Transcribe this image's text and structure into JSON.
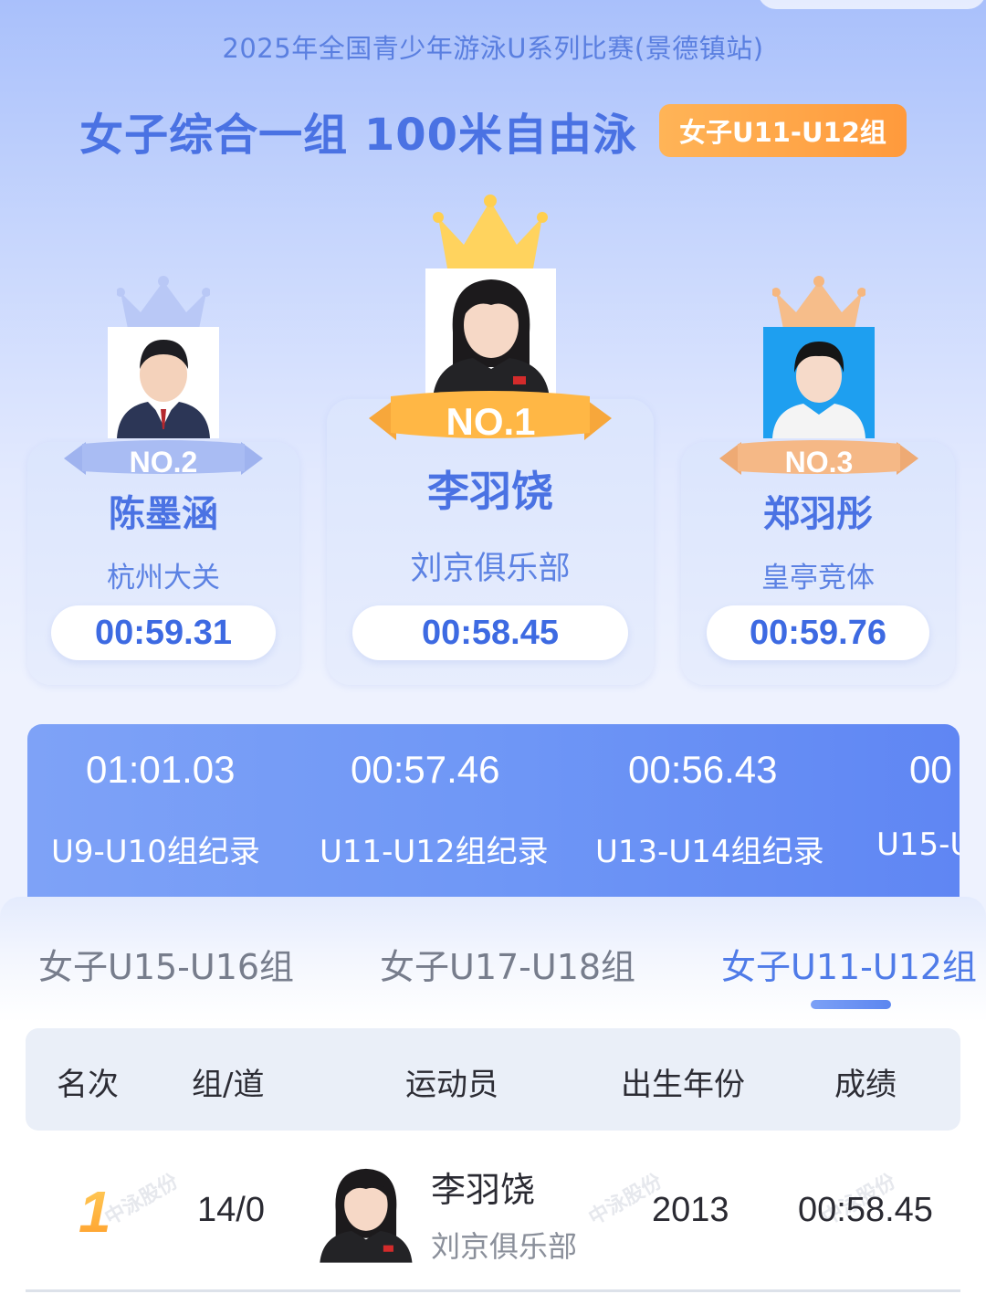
{
  "event_title": "2025年全国青少年游泳U系列比赛(景德镇站)",
  "heading": "女子综合一组 100米自由泳",
  "group_badge": "女子U11-U12组",
  "podium": [
    {
      "rank_label": "NO.2",
      "name": "陈墨涵",
      "club": "杭州大关",
      "time": "00:59.31",
      "crown_color": "#b9c8f6"
    },
    {
      "rank_label": "NO.1",
      "name": "李羽饶",
      "club": "刘京俱乐部",
      "time": "00:58.45",
      "crown_color": "#ffd35e"
    },
    {
      "rank_label": "NO.3",
      "name": "郑羽彤",
      "club": "皇亭竞体",
      "time": "00:59.76",
      "crown_color": "#f6bd8a"
    }
  ],
  "records": [
    {
      "time": "01:01.03",
      "label": "U9-U10组纪录"
    },
    {
      "time": "00:57.46",
      "label": "U11-U12组纪录"
    },
    {
      "time": "00:56.43",
      "label": "U13-U14组纪录"
    },
    {
      "time": "00",
      "label": "U15-U"
    }
  ],
  "tabs": [
    {
      "label": "女子U15-U16组",
      "active": false
    },
    {
      "label": "女子U17-U18组",
      "active": false
    },
    {
      "label": "女子U11-U12组",
      "active": true
    }
  ],
  "table": {
    "headers": [
      "名次",
      "组/道",
      "运动员",
      "出生年份",
      "成绩"
    ],
    "rows": [
      {
        "rank": "1",
        "heat_lane": "14/0",
        "athlete": "李羽饶",
        "club": "刘京俱乐部",
        "birth_year": "2013",
        "result": "00:58.45"
      }
    ]
  },
  "watermark": "中泳股份"
}
